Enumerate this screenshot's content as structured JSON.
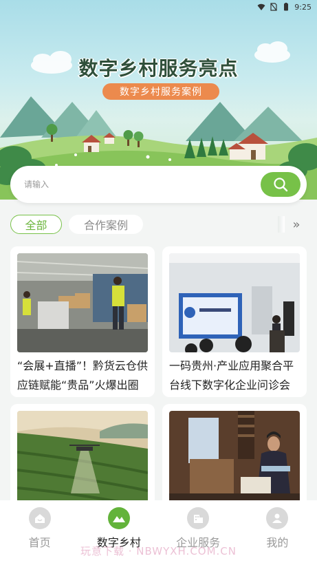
{
  "status_bar": {
    "time": "9:25"
  },
  "banner": {
    "title": "数字乡村服务亮点",
    "subtitle": "数字乡村服务案例"
  },
  "search": {
    "placeholder": "请输入"
  },
  "tabs": [
    {
      "label": "全部",
      "active": true
    },
    {
      "label": "合作案例",
      "active": false
    }
  ],
  "tabs_more_icon": "double-chevron-right-icon",
  "cards": [
    {
      "title": "“会展+直播”！黔货云仓供应链赋能“贵品”火爆出圈",
      "image": "warehouse-photo"
    },
    {
      "title": "一码贵州·产业应用聚合平台线下数字化企业问诊会",
      "image": "conference-photo"
    },
    {
      "title": "",
      "image": "tea-field-drone-photo"
    },
    {
      "title": "",
      "image": "craftswoman-photo"
    }
  ],
  "bottom_nav": [
    {
      "label": "首页",
      "icon": "home-icon",
      "active": false
    },
    {
      "label": "数字乡村",
      "icon": "mountain-icon",
      "active": true
    },
    {
      "label": "企业服务",
      "icon": "building-icon",
      "active": false
    },
    {
      "label": "我的",
      "icon": "user-icon",
      "active": false
    }
  ],
  "watermark": "玩意下载 · NBWYXH.COM.CN",
  "colors": {
    "accent": "#77c148",
    "pill": "#ec8a4d",
    "active_nav": "#63b33b"
  }
}
